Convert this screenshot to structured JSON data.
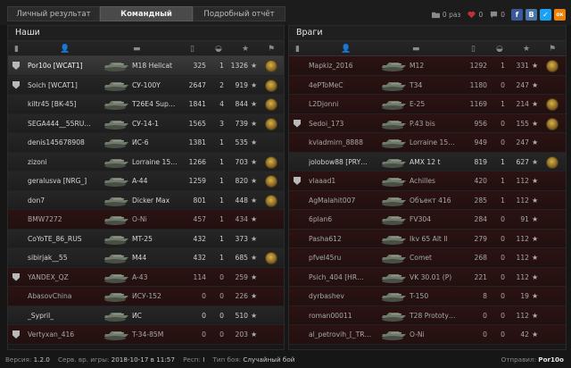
{
  "tabs": [
    {
      "label": "Личный результат",
      "active": false
    },
    {
      "label": "Командный результат",
      "active": true
    },
    {
      "label": "Подробный отчёт",
      "active": false
    }
  ],
  "topbar": {
    "views_label": "0 раз",
    "likes": "0",
    "comments": "0",
    "social": [
      "f",
      "В",
      "✓",
      "ок"
    ]
  },
  "left_team": {
    "title": "Наши",
    "players": [
      {
        "name": "Por10o [WCAT1]",
        "tank": "M18 Hellcat",
        "damage": "325",
        "kills": "1",
        "exp": "1326",
        "state": "me",
        "rank": true,
        "medal": true
      },
      {
        "name": "Soich [WCAT1]",
        "tank": "СУ-100Y",
        "damage": "2647",
        "kills": "2",
        "exp": "919",
        "state": "alive",
        "rank": true,
        "medal": true
      },
      {
        "name": "kiltr45 [BK-45]",
        "tank": "T26E4 Sup…",
        "damage": "1841",
        "kills": "4",
        "exp": "844",
        "state": "alive",
        "rank": false,
        "medal": true
      },
      {
        "name": "SEGA444__55RU…",
        "tank": "СУ-14-1",
        "damage": "1565",
        "kills": "3",
        "exp": "739",
        "state": "alive",
        "rank": false,
        "medal": true
      },
      {
        "name": "denis145678908",
        "tank": "ИС-6",
        "damage": "1381",
        "kills": "1",
        "exp": "535",
        "state": "alive",
        "rank": false,
        "medal": false
      },
      {
        "name": "zizoni",
        "tank": "Lorraine 15…",
        "damage": "1266",
        "kills": "1",
        "exp": "703",
        "state": "alive",
        "rank": false,
        "medal": true
      },
      {
        "name": "geralusva [NRG_]",
        "tank": "A-44",
        "damage": "1259",
        "kills": "1",
        "exp": "820",
        "state": "alive",
        "rank": false,
        "medal": true
      },
      {
        "name": "don7",
        "tank": "Dicker Max",
        "damage": "801",
        "kills": "1",
        "exp": "448",
        "state": "alive",
        "rank": false,
        "medal": true
      },
      {
        "name": "BMW7272",
        "tank": "O-Ni",
        "damage": "457",
        "kills": "1",
        "exp": "434",
        "state": "dead",
        "rank": false,
        "medal": false
      },
      {
        "name": "CoYoTE_86_RUS",
        "tank": "MT-25",
        "damage": "432",
        "kills": "1",
        "exp": "373",
        "state": "alive",
        "rank": false,
        "medal": false
      },
      {
        "name": "sibirjak__55",
        "tank": "M44",
        "damage": "432",
        "kills": "1",
        "exp": "685",
        "state": "alive",
        "rank": false,
        "medal": true
      },
      {
        "name": "YANDEX_QZ",
        "tank": "A-43",
        "damage": "114",
        "kills": "0",
        "exp": "259",
        "state": "dead",
        "rank": true,
        "medal": false
      },
      {
        "name": "AbasovChina",
        "tank": "ИСУ-152",
        "damage": "0",
        "kills": "0",
        "exp": "226",
        "state": "dead",
        "rank": false,
        "medal": false
      },
      {
        "name": "_Sypril_",
        "tank": "ИС",
        "damage": "0",
        "kills": "0",
        "exp": "510",
        "state": "alive",
        "rank": false,
        "medal": false
      },
      {
        "name": "Vertyxan_416",
        "tank": "T-34-85M",
        "damage": "0",
        "kills": "0",
        "exp": "203",
        "state": "dead",
        "rank": true,
        "medal": false
      }
    ]
  },
  "right_team": {
    "title": "Враги",
    "players": [
      {
        "name": "Mapkiz_2016",
        "tank": "M12",
        "damage": "1292",
        "kills": "1",
        "exp": "331",
        "state": "dead",
        "rank": false,
        "medal": true
      },
      {
        "name": "4ePToMeC",
        "tank": "T34",
        "damage": "1180",
        "kills": "0",
        "exp": "247",
        "state": "dead",
        "rank": false,
        "medal": false
      },
      {
        "name": "L2Djonni",
        "tank": "E-25",
        "damage": "1169",
        "kills": "1",
        "exp": "214",
        "state": "dead",
        "rank": false,
        "medal": true
      },
      {
        "name": "Sedoi_173",
        "tank": "P.43 bis",
        "damage": "956",
        "kills": "0",
        "exp": "155",
        "state": "dead",
        "rank": true,
        "medal": true
      },
      {
        "name": "kvladmirn_8888",
        "tank": "Lorraine 15…",
        "damage": "949",
        "kills": "0",
        "exp": "247",
        "state": "dead",
        "rank": false,
        "medal": false
      },
      {
        "name": "jolobow88 [PRY…",
        "tank": "AMX 12 t",
        "damage": "819",
        "kills": "1",
        "exp": "627",
        "state": "alive",
        "rank": false,
        "medal": true
      },
      {
        "name": "vlaaad1",
        "tank": "Achilles",
        "damage": "420",
        "kills": "1",
        "exp": "112",
        "state": "dead",
        "rank": true,
        "medal": false
      },
      {
        "name": "AgMalahit007",
        "tank": "Объект 416",
        "damage": "285",
        "kills": "1",
        "exp": "112",
        "state": "dead",
        "rank": false,
        "medal": false
      },
      {
        "name": "6plan6",
        "tank": "FV304",
        "damage": "284",
        "kills": "0",
        "exp": "91",
        "state": "dead",
        "rank": false,
        "medal": false
      },
      {
        "name": "Pasha612",
        "tank": "Ikv 65 Alt II",
        "damage": "279",
        "kills": "0",
        "exp": "112",
        "state": "dead",
        "rank": false,
        "medal": false
      },
      {
        "name": "pfvel45ru",
        "tank": "Comet",
        "damage": "268",
        "kills": "0",
        "exp": "112",
        "state": "dead",
        "rank": false,
        "medal": false
      },
      {
        "name": "Psich_404 [HR…",
        "tank": "VK 30.01 (P)",
        "damage": "221",
        "kills": "0",
        "exp": "112",
        "state": "dead",
        "rank": false,
        "medal": false
      },
      {
        "name": "dyrbashev",
        "tank": "T-150",
        "damage": "8",
        "kills": "0",
        "exp": "19",
        "state": "dead",
        "rank": false,
        "medal": false
      },
      {
        "name": "roman00011",
        "tank": "T28 Prototy…",
        "damage": "0",
        "kills": "0",
        "exp": "112",
        "state": "dead",
        "rank": false,
        "medal": false
      },
      {
        "name": "al_petrovih_[_TR…",
        "tank": "O-Ni",
        "damage": "0",
        "kills": "0",
        "exp": "42",
        "state": "dead",
        "rank": false,
        "medal": false
      }
    ]
  },
  "footer": {
    "version_label": "Версия:",
    "version": "1.2.0",
    "server_label": "Серв. вр. игры:",
    "server_time": "2018-10-17 в 11:57",
    "respawn_label": "Респ:",
    "respawn": "I",
    "type_label": "Тип боя:",
    "type": "Случайный бой",
    "sender_label": "Отправил:",
    "sender": "Por10o"
  }
}
